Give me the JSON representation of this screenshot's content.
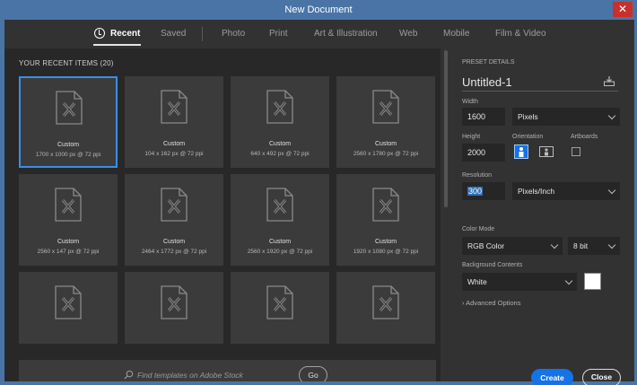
{
  "window": {
    "title": "New Document",
    "close_glyph": "✕"
  },
  "tabs": [
    {
      "label": "Recent",
      "active": true
    },
    {
      "label": "Saved"
    },
    {
      "label": "Photo"
    },
    {
      "label": "Print"
    },
    {
      "label": "Art & Illustration"
    },
    {
      "label": "Web"
    },
    {
      "label": "Mobile"
    },
    {
      "label": "Film & Video"
    }
  ],
  "recent": {
    "header": "YOUR RECENT ITEMS",
    "count": "(20)",
    "items": [
      {
        "title": "Custom",
        "size": "1700 x 1000 px @ 72 ppi"
      },
      {
        "title": "Custom",
        "size": "104 x 162 px @ 72 ppi"
      },
      {
        "title": "Custom",
        "size": "640 x 492 px @ 72 ppi"
      },
      {
        "title": "Custom",
        "size": "2560 x 1780 px @ 72 ppi"
      },
      {
        "title": "Custom",
        "size": "2560 x 147 px @ 72 ppi"
      },
      {
        "title": "Custom",
        "size": "2464 x 1772 px @ 72 ppi"
      },
      {
        "title": "Custom",
        "size": "2560 x 1920 px @ 72 ppi"
      },
      {
        "title": "Custom",
        "size": "1920 x 1080 px @ 72 ppi"
      }
    ]
  },
  "search": {
    "placeholder": "Find templates on Adobe Stock",
    "go_label": "Go"
  },
  "preset": {
    "section_label": "PRESET DETAILS",
    "name": "Untitled-1",
    "width_label": "Width",
    "width": "1600",
    "width_unit": "Pixels",
    "height_label": "Height",
    "height": "2000",
    "orientation_label": "Orientation",
    "artboards_label": "Artboards",
    "resolution_label": "Resolution",
    "resolution": "300",
    "resolution_unit": "Pixels/Inch",
    "color_mode_label": "Color Mode",
    "color_mode": "RGB Color",
    "bit_depth": "8 bit",
    "background_label": "Background Contents",
    "background": "White",
    "background_color": "#ffffff",
    "advanced_label": "Advanced Options"
  },
  "actions": {
    "create_label": "Create",
    "close_label": "Close"
  },
  "colors": {
    "accent": "#1473e6",
    "selection": "#3a8ee6"
  }
}
